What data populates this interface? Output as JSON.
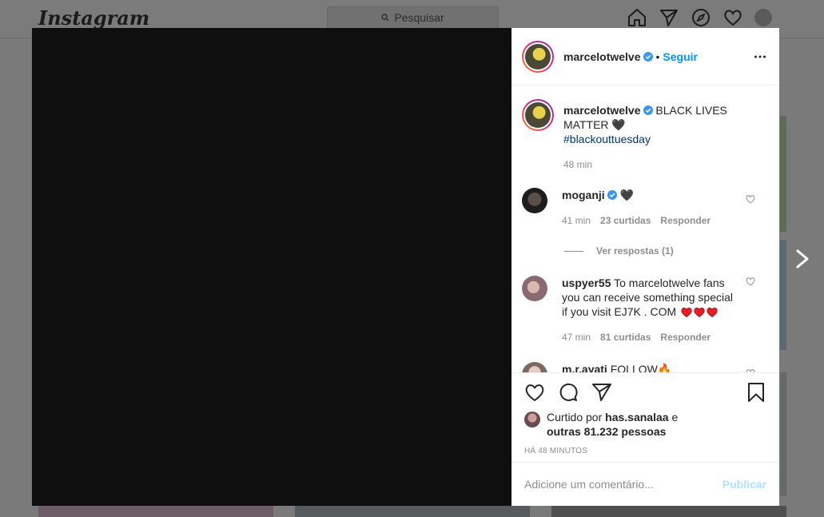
{
  "header": {
    "logo": "Instagram",
    "search_placeholder": "Pesquisar",
    "icons": [
      "home-icon",
      "direct-icon",
      "explore-icon",
      "activity-icon",
      "profile-avatar"
    ]
  },
  "post": {
    "username": "marcelotwelve",
    "verified": true,
    "follow_label": "Seguir",
    "separator": "•"
  },
  "caption": {
    "username": "marcelotwelve",
    "text": "BLACK LIVES MATTER 🖤",
    "hashtag": "#blackouttuesday",
    "time": "48 min"
  },
  "comments": [
    {
      "username": "moganji",
      "verified": true,
      "text": "🖤",
      "time": "41 min",
      "likes": "23 curtidas",
      "reply": "Responder",
      "view_replies": "Ver respostas (1)"
    },
    {
      "username": "uspyer55",
      "verified": false,
      "text": "To marcelotwelve fans you can receive something special if you visit EJ7K . COM",
      "hearts": 3,
      "time": "47 min",
      "likes": "81 curtidas",
      "reply": "Responder"
    },
    {
      "username": "m.r.ayati",
      "verified": false,
      "text": "FOLLOW🔥"
    }
  ],
  "likes": {
    "prefix": "Curtido por",
    "user": "has.sanalaa",
    "connector": "e",
    "others": "outras 81.232 pessoas"
  },
  "timestamp": "HÁ 48 MINUTOS",
  "comment_input": {
    "placeholder": "Adicione um comentário...",
    "publish_label": "Publicar"
  },
  "colors": {
    "accent": "#0095f6",
    "publish_disabled": "#b2dffc",
    "hashtag": "#00376b",
    "heart_red": "#ed1c24"
  }
}
